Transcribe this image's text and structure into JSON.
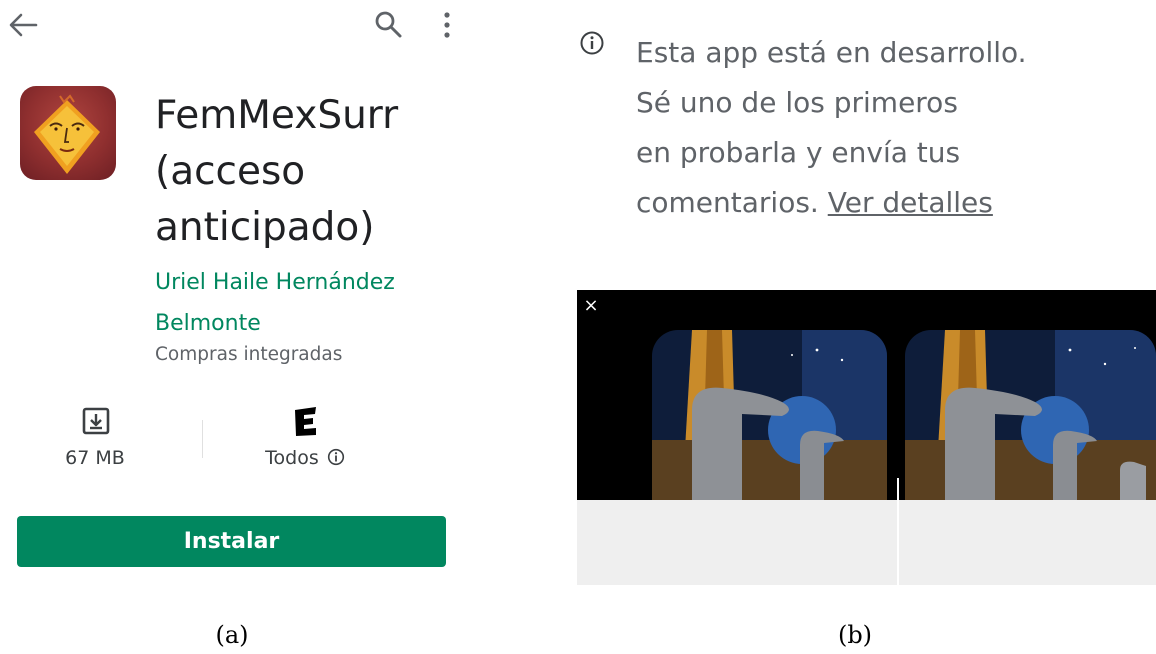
{
  "panel_a": {
    "toolbar": {
      "back_icon": "arrow-left-icon",
      "search_icon": "search-icon",
      "more_icon": "more-vert-icon"
    },
    "app": {
      "icon": "app-logo-face-icon",
      "title_line1": "FemMexSurr",
      "title_line2": "(acceso",
      "title_line3": "anticipado)",
      "developer_line1": "Uriel Haile Hernández",
      "developer_line2": "Belmonte",
      "in_app_purchases": "Compras integradas"
    },
    "stats": {
      "size_icon": "download-box-icon",
      "size_value": "67 MB",
      "rating_icon": "esrb-e-icon",
      "rating_label": "Todos",
      "rating_info_icon": "info-icon"
    },
    "install_label": "Instalar",
    "caption": "(a)"
  },
  "panel_b": {
    "notice_icon": "info-icon",
    "notice_line1": "Esta app está en desarrollo.",
    "notice_line2": "Sé uno de los primeros",
    "notice_line3": "en probarla y envía tus",
    "notice_line4": "comentarios.",
    "details_link": "Ver detalles",
    "video_close": "×",
    "caption": "(b)"
  },
  "colors": {
    "accent_green": "#01875f",
    "text_secondary": "#5f6368",
    "text_primary": "#202124"
  }
}
